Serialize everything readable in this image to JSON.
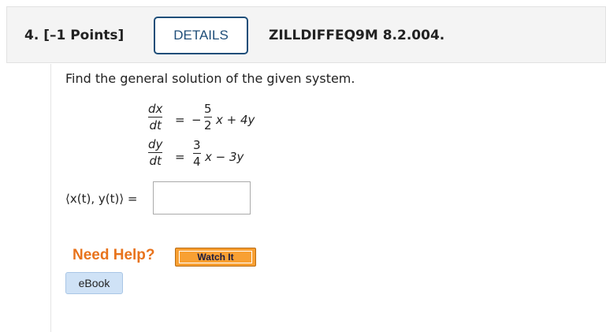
{
  "question": {
    "number_label": "4. [–1 Points]",
    "details_label": "DETAILS",
    "id": "ZILLDIFFEQ9M 8.2.004."
  },
  "prompt": "Find the general solution of the given system.",
  "system": {
    "eq1": {
      "lhs_num": "dx",
      "lhs_den": "dt",
      "eq": "=",
      "sign": "−",
      "coef_num": "5",
      "coef_den": "2",
      "rest": "x + 4y"
    },
    "eq2": {
      "lhs_num": "dy",
      "lhs_den": "dt",
      "eq": "=",
      "coef_num": "3",
      "coef_den": "4",
      "rest": "x − 3y"
    }
  },
  "answer": {
    "label": "⟨x(t), y(t)⟩  =",
    "value": ""
  },
  "help": {
    "need_help": "Need Help?",
    "watch_label": "Watch It",
    "ebook_label": "eBook"
  }
}
